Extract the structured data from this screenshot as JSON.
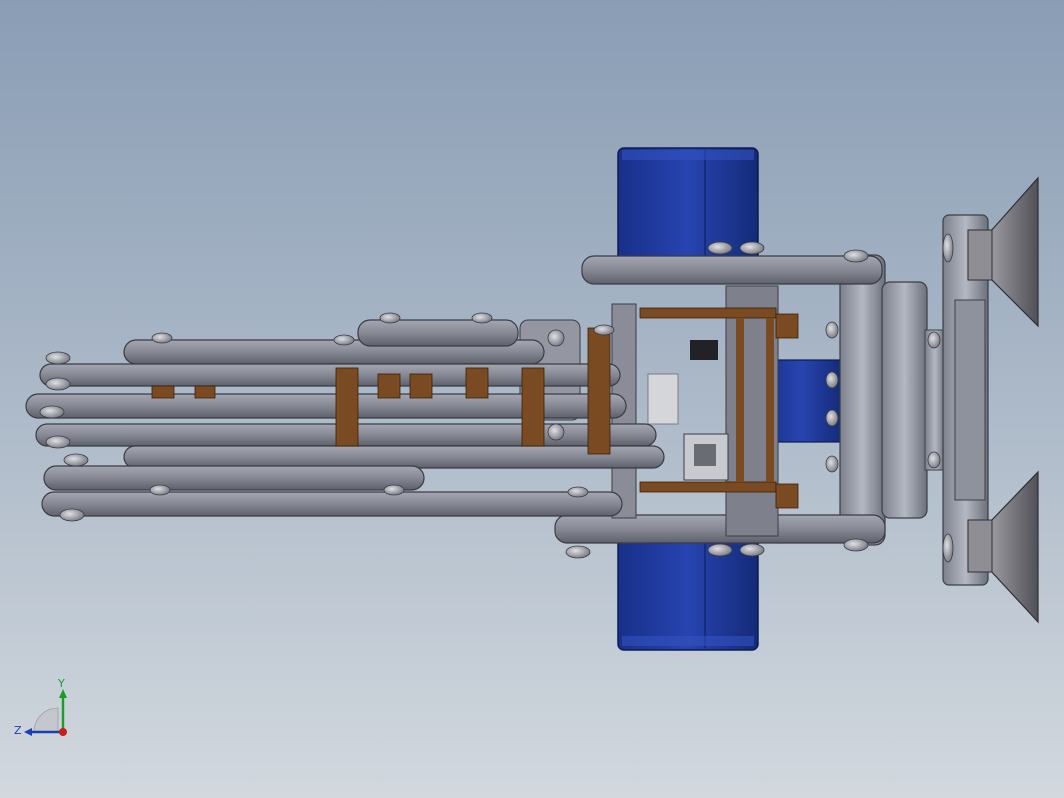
{
  "viewport": {
    "background_top": "#8a9db5",
    "background_bottom": "#d2d8de"
  },
  "model": {
    "description_icon": "robotic-gripper-assembly",
    "colors": {
      "link_gray": "#8a8c98",
      "link_dark": "#5a5c66",
      "motor_blue": "#1f3b9c",
      "motor_blue_dark": "#142a78",
      "spacer_brown": "#7a4a22",
      "hub_gray": "#9aa0ac",
      "suction_cup": "#6e6e72"
    }
  },
  "triad": {
    "y_label": "Y",
    "z_label": "Z",
    "y_color": "#1e9b2a",
    "z_color": "#1c3fb0",
    "x_color": "#c81e1e"
  }
}
